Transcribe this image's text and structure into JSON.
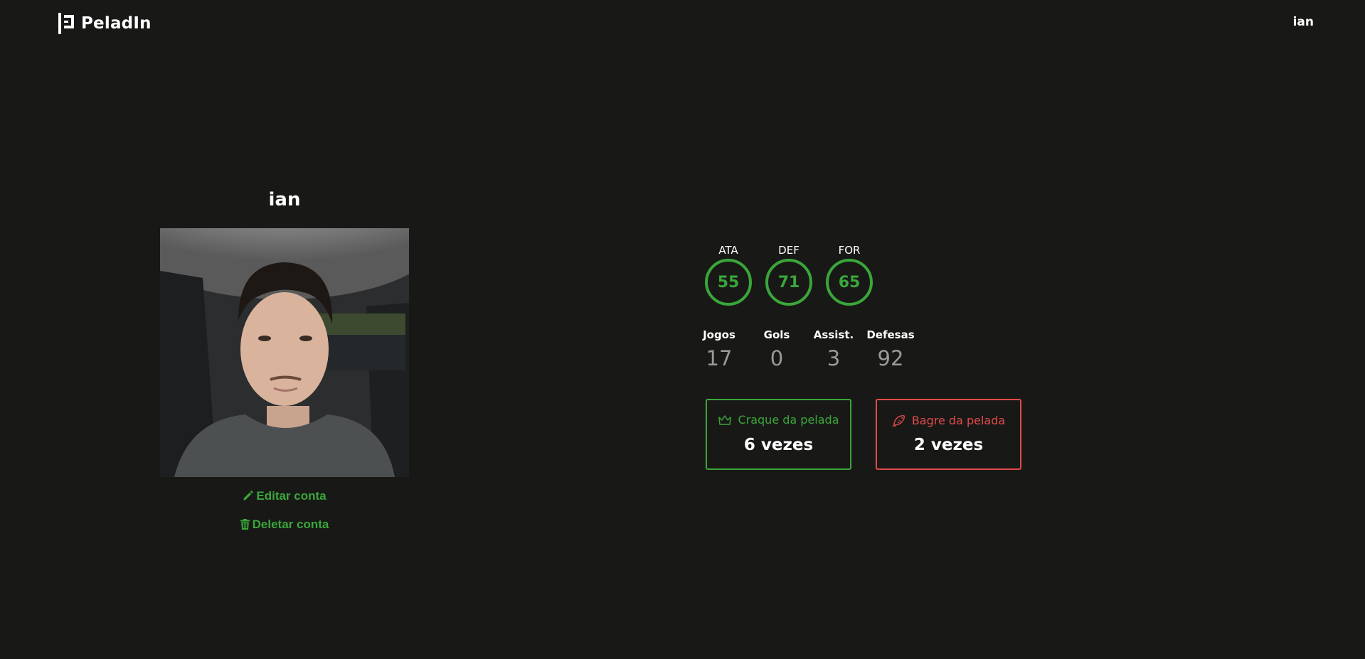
{
  "header": {
    "brand": "PeladIn",
    "user": "ian"
  },
  "profile": {
    "name": "ian",
    "edit_label": "Editar conta",
    "delete_label": "Deletar conta"
  },
  "attributes": [
    {
      "label": "ATA",
      "value": "55"
    },
    {
      "label": "DEF",
      "value": "71"
    },
    {
      "label": "FOR",
      "value": "65"
    }
  ],
  "stats": [
    {
      "label": "Jogos",
      "value": "17"
    },
    {
      "label": "Gols",
      "value": "0"
    },
    {
      "label": "Assist.",
      "value": "3"
    },
    {
      "label": "Defesas",
      "value": "92"
    }
  ],
  "awards": {
    "craque": {
      "label": "Craque da pelada",
      "value": "6 vezes",
      "icon": "crown-icon"
    },
    "bagre": {
      "label": "Bagre da pelada",
      "value": "2 vezes",
      "icon": "fish-icon"
    }
  },
  "colors": {
    "background": "#181917",
    "accent_green": "#3aa63a",
    "accent_red": "#e24a4a",
    "muted": "#9a9a9a"
  }
}
